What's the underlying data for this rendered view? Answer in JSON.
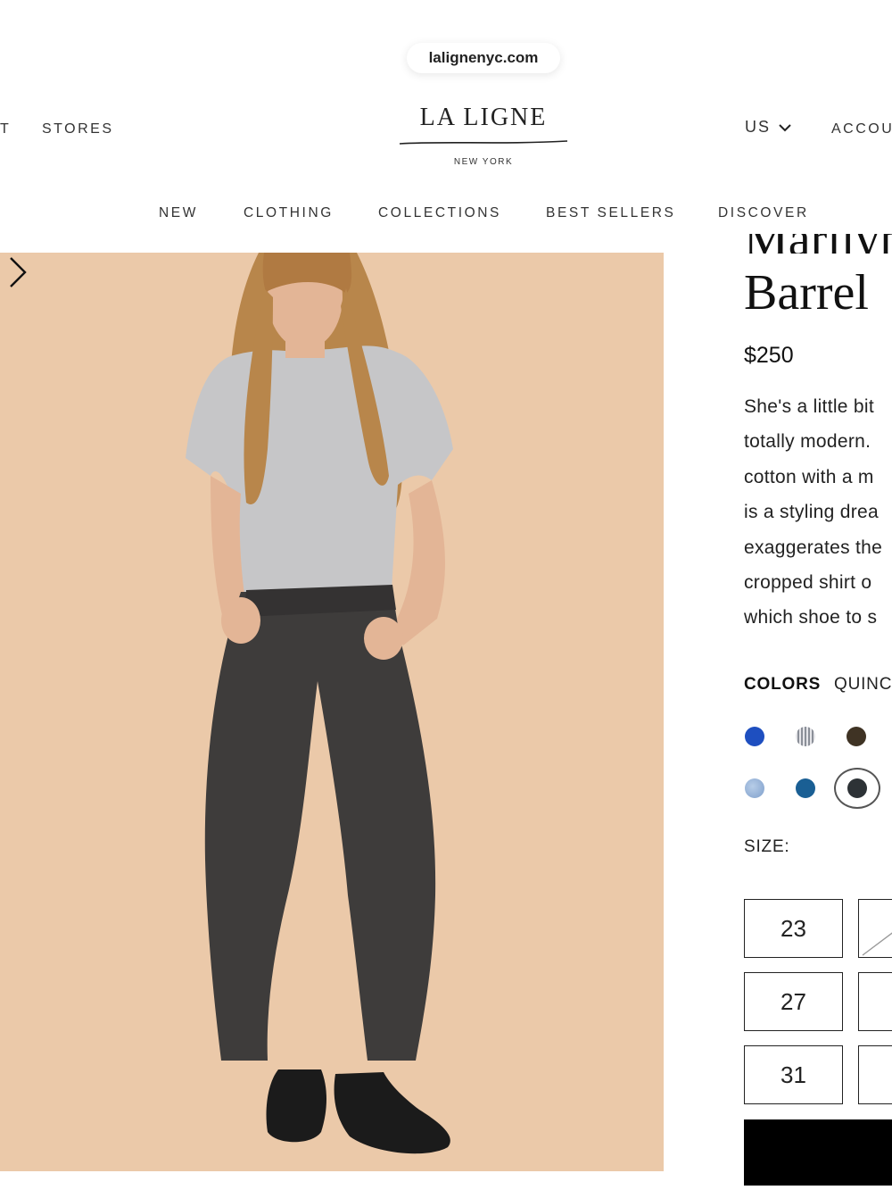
{
  "browser": {
    "url": "lalignenyc.com"
  },
  "header": {
    "left_links": [
      "T",
      "STORES"
    ],
    "logo_main": "LA LIGNE",
    "logo_sub": "NEW YORK",
    "region": "US",
    "account": "ACCOU"
  },
  "nav": {
    "items": [
      "NEW",
      "CLOTHING",
      "COLLECTIONS",
      "BEST SELLERS",
      "DISCOVER"
    ]
  },
  "product": {
    "title_top_clipped": "Marilyn",
    "title_line": "Barrel",
    "price": "$250",
    "description_lines": [
      "She's a little bit",
      "totally modern.",
      "cotton with a m",
      "is a styling drea",
      "exaggerates the",
      "cropped shirt o",
      "which shoe to s"
    ],
    "colors_label": "COLORS",
    "selected_color": "QUINC",
    "swatches": [
      {
        "name": "cobalt",
        "color": "#1e4fc0"
      },
      {
        "name": "stripe",
        "color": "#b9bcc4"
      },
      {
        "name": "brown",
        "color": "#3f3324"
      },
      {
        "name": "light-wash",
        "color": "#8fb0d8"
      },
      {
        "name": "teal-blue",
        "color": "#1a5f94"
      },
      {
        "name": "charcoal",
        "color": "#2d3236"
      }
    ],
    "size_label": "SIZE:",
    "sizes": [
      "23",
      "27",
      "31"
    ]
  },
  "colors": {
    "background_photo": "#ebc9a9",
    "accent": "#000000"
  }
}
